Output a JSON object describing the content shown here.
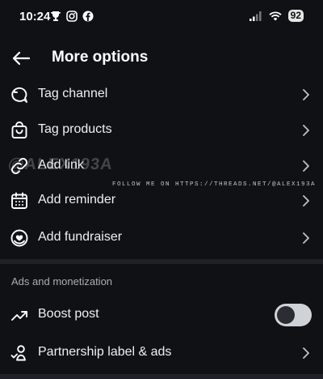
{
  "status_bar": {
    "time": "10:24",
    "left_icons": [
      "trophy-icon",
      "instagram-icon",
      "facebook-icon"
    ],
    "right_icons": [
      "signal-icon",
      "wifi-icon",
      "battery-icon"
    ],
    "battery": "92"
  },
  "header": {
    "title": "More options"
  },
  "menu": {
    "items": [
      {
        "label": "Tag channel",
        "icon": "tag-channel-icon"
      },
      {
        "label": "Tag products",
        "icon": "shopping-bag-icon"
      },
      {
        "label": "Add link",
        "icon": "link-icon"
      },
      {
        "label": "Add reminder",
        "icon": "calendar-icon"
      },
      {
        "label": "Add fundraiser",
        "icon": "fundraiser-icon"
      }
    ]
  },
  "monetization": {
    "section_label": "Ads and monetization",
    "boost": {
      "label": "Boost post",
      "icon": "trending-up-icon",
      "enabled": false
    },
    "partnership": {
      "label": "Partnership label & ads",
      "icon": "partnership-icon"
    }
  },
  "overlay": {
    "watermark": "@ALEX193A",
    "follow_text": "FOLLOW ME ON HTTPS://THREADS.NET/@ALEX193A"
  },
  "colors": {
    "background": "#0f1115",
    "text": "#f0f0f0",
    "secondary_text": "#a9adb3",
    "toggle_track": "#cfd3d8"
  }
}
